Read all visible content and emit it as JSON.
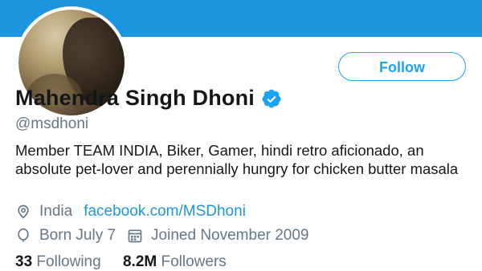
{
  "profile": {
    "name": "Mahendra Singh Dhoni",
    "handle": "@msdhoni",
    "bio": "Member TEAM INDIA, Biker, Gamer, hindi retro aficionado, an absolute pet-lover and perennially hungry for chicken butter masala",
    "location": "India",
    "website": "facebook.com/MSDhoni",
    "birthday": "Born July 7",
    "joined": "Joined November 2009",
    "following_count": "33",
    "following_label": "Following",
    "followers_count": "8.2M",
    "followers_label": "Followers"
  },
  "actions": {
    "follow_label": "Follow"
  },
  "colors": {
    "banner": "#1b95e0",
    "accent": "#1da1f2",
    "secondary_text": "#657786",
    "primary_text": "#14171a"
  },
  "icons": {
    "verified": "verified-badge-icon",
    "location": "location-pin-icon",
    "birthday": "balloon-icon",
    "joined": "calendar-icon"
  }
}
